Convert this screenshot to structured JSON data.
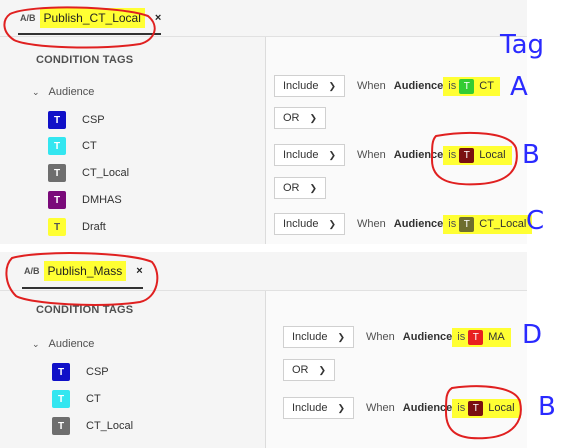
{
  "panel1": {
    "tab": {
      "ab": "A/B",
      "name": "Publish_CT_Local",
      "close": "×"
    },
    "section_title": "CONDITION TAGS",
    "group": {
      "label": "Audience",
      "chevron": "⌄"
    },
    "tags": [
      {
        "label": "CSP",
        "color": "#1010c8",
        "letter": "T"
      },
      {
        "label": "CT",
        "color": "#33e6f0",
        "letter": "T"
      },
      {
        "label": "CT_Local",
        "color": "#6e6e6e",
        "letter": "T"
      },
      {
        "label": "DMHAS",
        "color": "#7a0a7a",
        "letter": "T"
      },
      {
        "label": "Draft",
        "color": "#ffff33",
        "letter": "T"
      }
    ],
    "rules": [
      {
        "mode": "Include",
        "when": "When",
        "field": "Audience",
        "is": "is",
        "value": "CT",
        "chip_color": "#33cc33"
      },
      {
        "mode": "Include",
        "when": "When",
        "field": "Audience",
        "is": "is",
        "value": "Local",
        "chip_color": "#7a1010"
      },
      {
        "mode": "Include",
        "when": "When",
        "field": "Audience",
        "is": "is",
        "value": "CT_Local",
        "chip_color": "#6e6e2e"
      }
    ],
    "connectors": [
      "OR",
      "OR"
    ]
  },
  "panel2": {
    "tab": {
      "ab": "A/B",
      "name": "Publish_Mass",
      "close": "×"
    },
    "section_title": "CONDITION TAGS",
    "group": {
      "label": "Audience",
      "chevron": "⌄"
    },
    "tags": [
      {
        "label": "CSP",
        "color": "#1010c8",
        "letter": "T"
      },
      {
        "label": "CT",
        "color": "#33e6f0",
        "letter": "T"
      },
      {
        "label": "CT_Local",
        "color": "#6e6e6e",
        "letter": "T"
      }
    ],
    "rules": [
      {
        "mode": "Include",
        "when": "When",
        "field": "Audience",
        "is": "is",
        "value": "MA",
        "chip_color": "#e82020"
      },
      {
        "mode": "Include",
        "when": "When",
        "field": "Audience",
        "is": "is",
        "value": "Local",
        "chip_color": "#7a1010"
      }
    ],
    "connectors": [
      "OR"
    ]
  },
  "annotations": {
    "heading": "Tag",
    "letters": [
      "A",
      "B",
      "C",
      "D",
      "B"
    ]
  },
  "colors": {
    "highlight": "#ffff33",
    "ink_red": "#e02020",
    "ink_blue": "#2a2aff"
  }
}
